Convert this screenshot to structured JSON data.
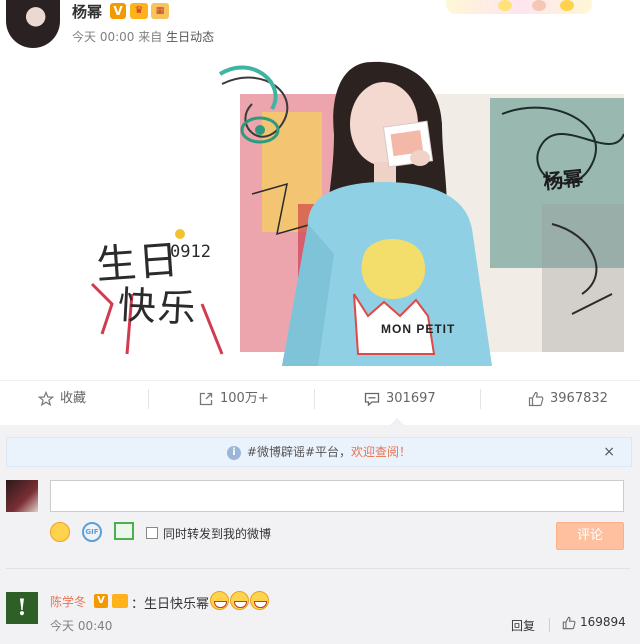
{
  "post": {
    "username": "杨幂",
    "verified_badge": "V",
    "time": "今天 00:00",
    "from_label": "来自",
    "source": "生日动态",
    "image": {
      "text_birthday": "生日",
      "text_happy": "快乐",
      "text_date": "0912",
      "text_signature": "杨幂",
      "text_shirt": "MON PETIT"
    }
  },
  "actions": {
    "favorite": "收藏",
    "repost": "100万+",
    "comment": "301697",
    "like": "3967832"
  },
  "notice": {
    "text": "#微博辟谣#平台，",
    "link": "欢迎查阅！",
    "close": "×"
  },
  "composer": {
    "input_value": "",
    "gif_label": "GIF",
    "repost_option": "同时转发到我的微博",
    "submit": "评论"
  },
  "comment": {
    "avatar_glyph": "!",
    "username": "陈学冬",
    "verified_badge": "V",
    "text": "：生日快乐幂",
    "time": "今天 00:40",
    "reply": "回复",
    "likes": "169894"
  },
  "colors": {
    "accent": "#eb7350",
    "verified": "#f49a00",
    "submit_disabled": "#ffc09f",
    "panel_bg": "#f2f2f5"
  },
  "icons": {
    "favorite": "star-icon",
    "repost": "share-icon",
    "comment": "comment-icon",
    "like": "thumbs-up-icon",
    "notice": "info-icon",
    "emoji": "smiley-icon",
    "gif": "gif-icon",
    "image": "image-icon"
  }
}
